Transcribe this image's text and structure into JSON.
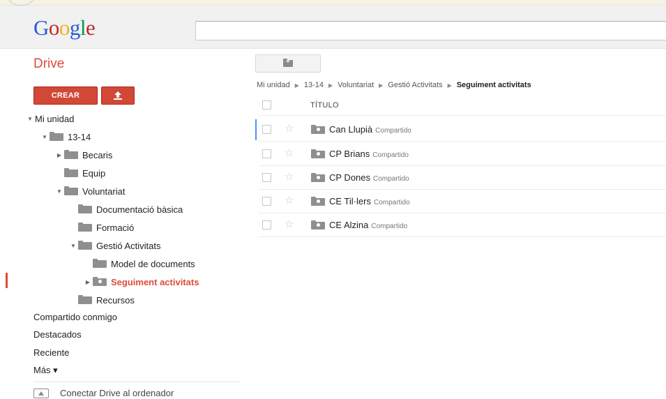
{
  "header": {
    "logo_letters": [
      {
        "char": "G",
        "color": "#2a5bd7"
      },
      {
        "char": "o",
        "color": "#c1272d"
      },
      {
        "char": "o",
        "color": "#f1b31c"
      },
      {
        "char": "g",
        "color": "#2a5bd7"
      },
      {
        "char": "l",
        "color": "#009a49"
      },
      {
        "char": "e",
        "color": "#c1272d"
      }
    ],
    "search_value": ""
  },
  "app": {
    "title": "Drive",
    "accent_color": "#dd4b39"
  },
  "actions": {
    "create_label": "CREAR",
    "upload_icon": "upload-arrow-icon",
    "new_folder_icon": "folder-plus-icon"
  },
  "tree": {
    "items": [
      {
        "label": "Mi unidad",
        "arrow": "▼",
        "icon": "none"
      },
      {
        "label": "13-14",
        "arrow": "▼",
        "icon": "folder-icon"
      },
      {
        "label": "Becaris",
        "arrow": "▶",
        "icon": "folder-icon"
      },
      {
        "label": "Equip",
        "arrow": "",
        "icon": "folder-icon"
      },
      {
        "label": "Voluntariat",
        "arrow": "▼",
        "icon": "folder-icon"
      },
      {
        "label": "Documentació bàsica",
        "arrow": "",
        "icon": "folder-icon"
      },
      {
        "label": "Formació",
        "arrow": "",
        "icon": "folder-icon"
      },
      {
        "label": "Gestió Activitats",
        "arrow": "▼",
        "icon": "folder-icon"
      },
      {
        "label": "Model de documents",
        "arrow": "",
        "icon": "folder-icon"
      },
      {
        "label": "Seguiment activitats",
        "arrow": "▶",
        "icon": "shared-folder-icon",
        "selected": true
      },
      {
        "label": "Recursos",
        "arrow": "",
        "icon": "folder-icon"
      }
    ]
  },
  "nav": {
    "shared": "Compartido conmigo",
    "starred": "Destacados",
    "recent": "Reciente",
    "more": "Más ▾",
    "connect": "Conectar Drive al ordenador"
  },
  "breadcrumb": {
    "items": [
      "Mi unidad",
      "13-14",
      "Voluntariat",
      "Gestió Activitats"
    ],
    "current": "Seguiment activitats",
    "separator": "▶"
  },
  "list": {
    "header_title": "TÍTULO",
    "rows": [
      {
        "name": "Can Llupià",
        "status": "Compartido",
        "icon": "shared-folder-icon"
      },
      {
        "name": "CP Brians",
        "status": "Compartido",
        "icon": "shared-folder-icon"
      },
      {
        "name": "CP Dones",
        "status": "Compartido",
        "icon": "shared-folder-icon"
      },
      {
        "name": "CE Til·lers",
        "status": "Compartido",
        "icon": "shared-folder-icon"
      },
      {
        "name": "CE Alzina",
        "status": "Compartido",
        "icon": "shared-folder-icon"
      }
    ]
  }
}
